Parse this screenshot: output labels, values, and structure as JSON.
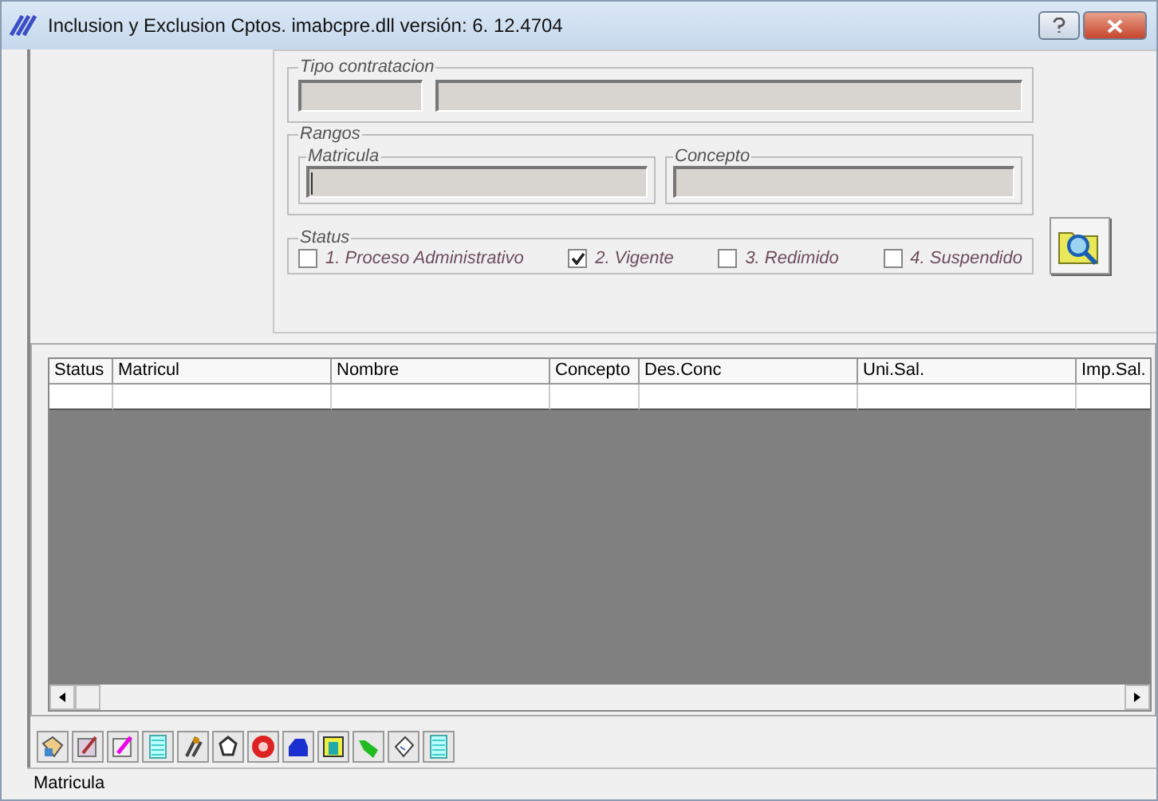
{
  "window": {
    "title": "Inclusion y Exclusion Cptos. imabcpre.dll  versión: 6. 12.4704"
  },
  "tipo_contratacion": {
    "legend": "Tipo contratacion"
  },
  "rangos": {
    "legend": "Rangos",
    "matricula": {
      "legend": "Matricula"
    },
    "concepto": {
      "legend": "Concepto"
    }
  },
  "status": {
    "legend": "Status",
    "options": [
      {
        "label": "1. Proceso Administrativo",
        "checked": false
      },
      {
        "label": "2. Vigente",
        "checked": true
      },
      {
        "label": "3. Redimido",
        "checked": false
      },
      {
        "label": "4. Suspendido",
        "checked": false
      }
    ]
  },
  "table": {
    "columns": [
      "Status",
      "Matricul",
      "Nombre",
      "Concepto",
      "Des.Conc",
      "Uni.Sal.",
      "Imp.Sal."
    ]
  },
  "status_bar": "Matricula"
}
